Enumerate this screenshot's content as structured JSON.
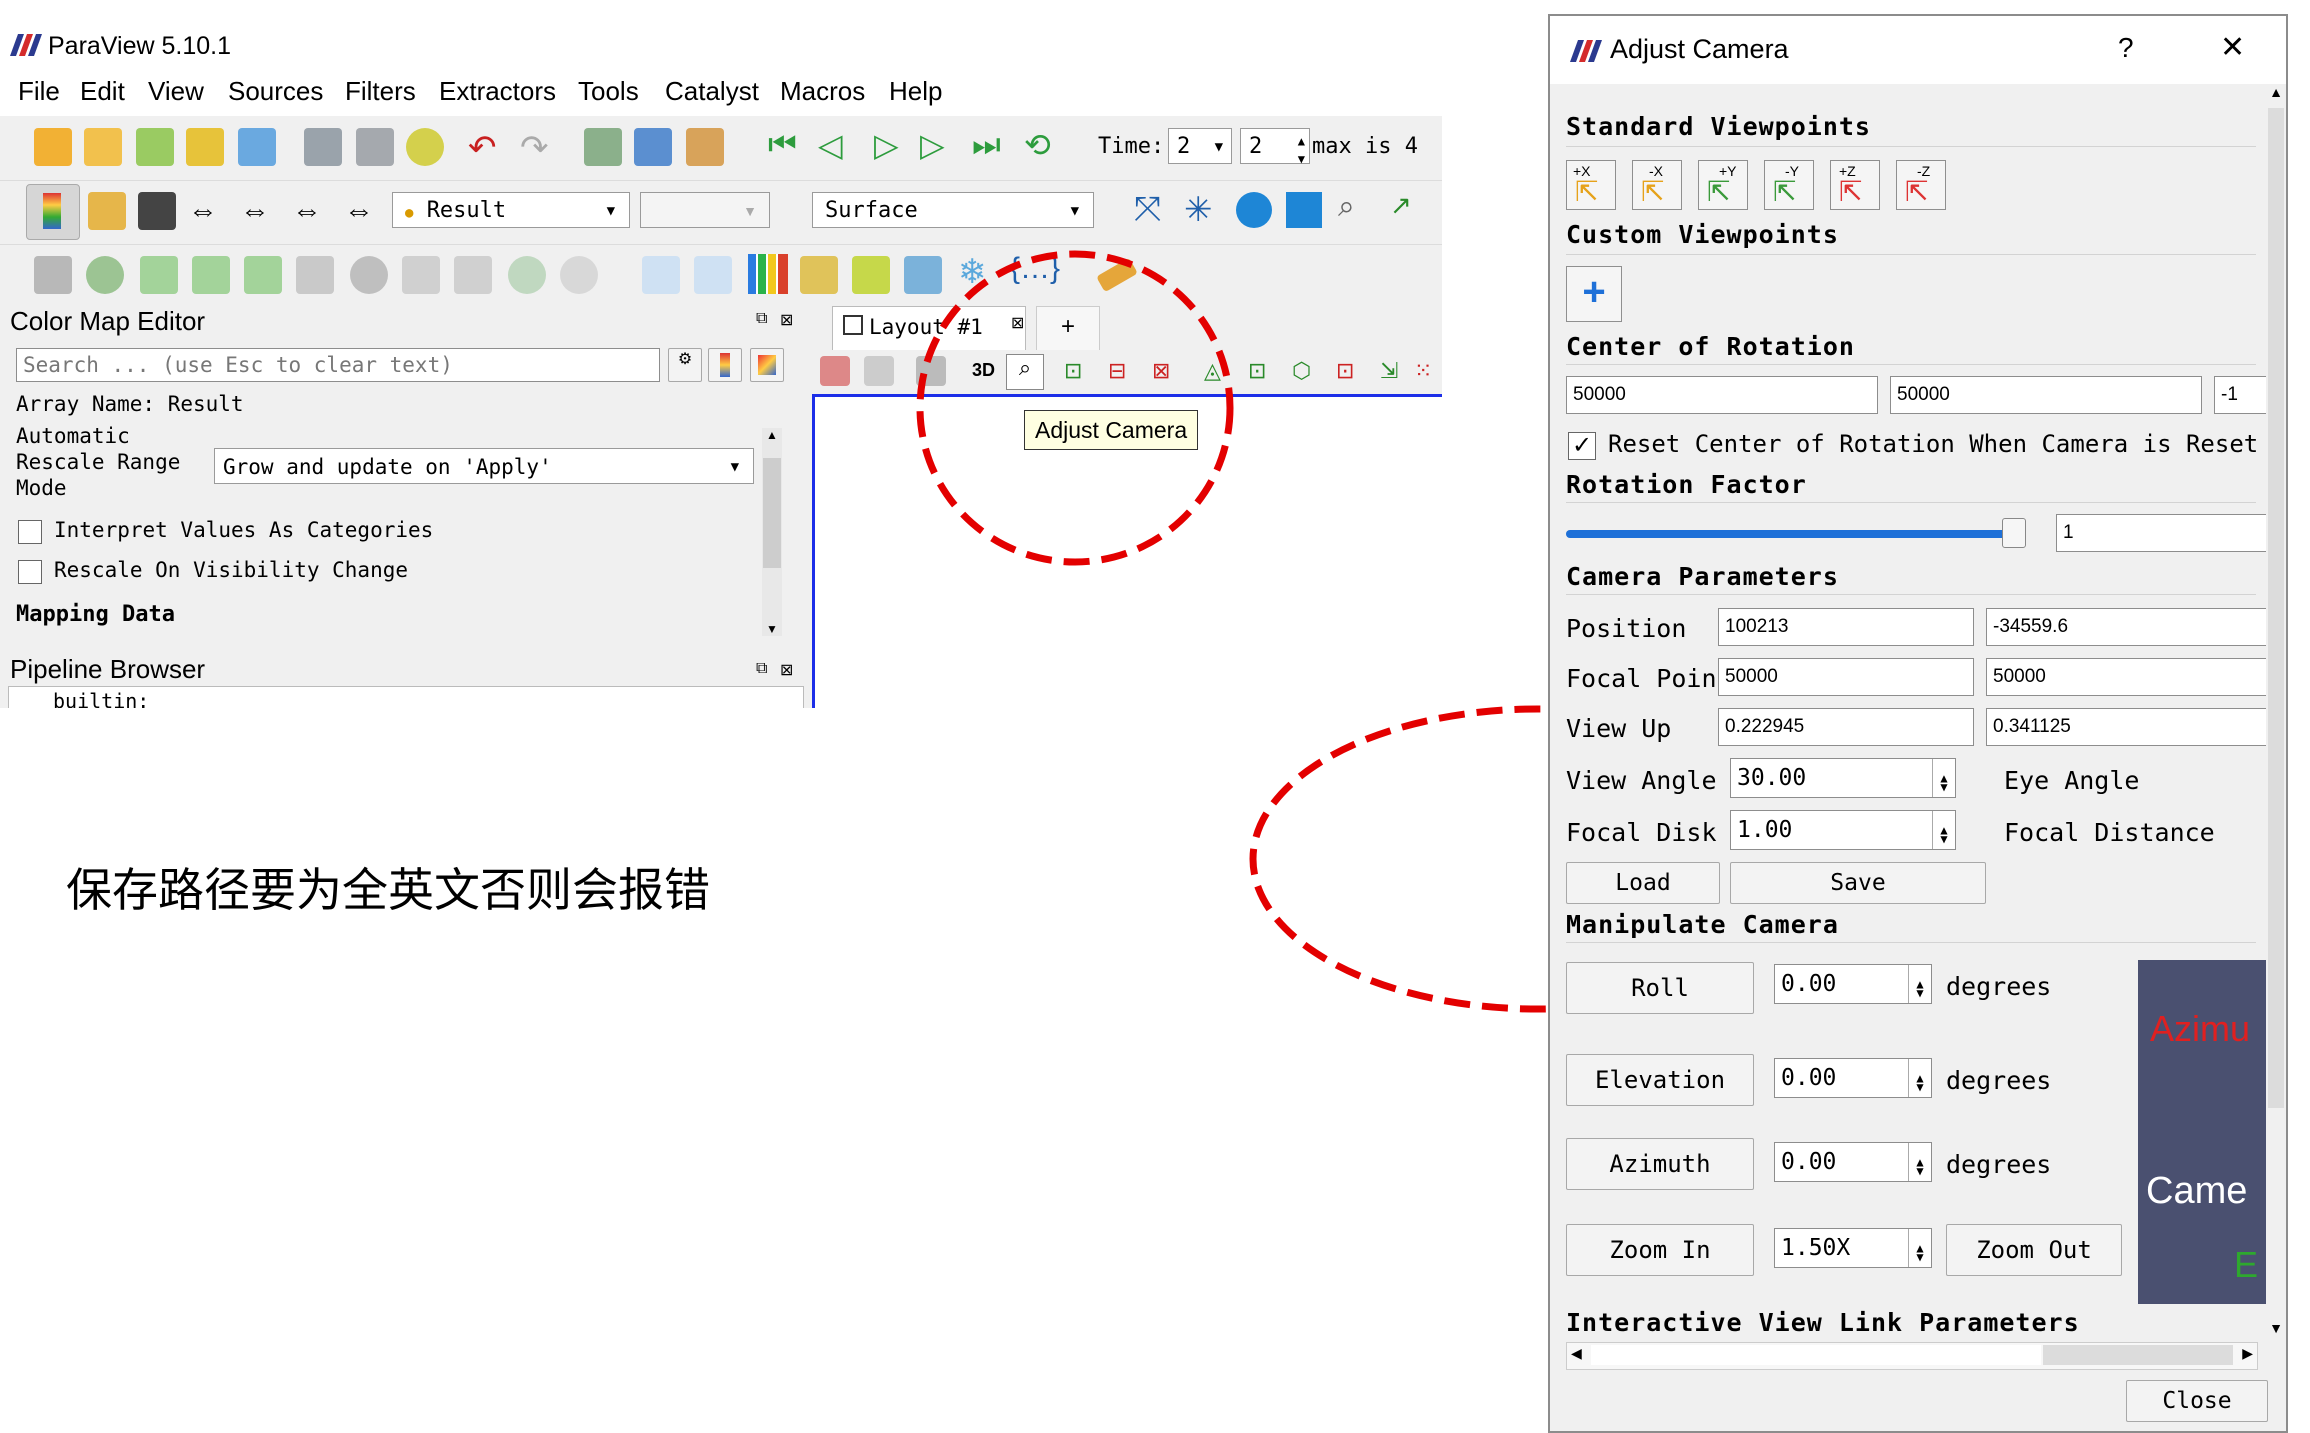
{
  "app": {
    "title": "ParaView 5.10.1",
    "menu": [
      "File",
      "Edit",
      "View",
      "Sources",
      "Filters",
      "Extractors",
      "Tools",
      "Catalyst",
      "Macros",
      "Help"
    ],
    "time_label": "Time:",
    "time_combo_value": "2",
    "time_spin_value": "2",
    "time_max": "max is 4",
    "result_combo": "Result",
    "representation_combo": "Surface"
  },
  "color_map_editor": {
    "title": "Color Map Editor",
    "search_placeholder": "Search ... (use Esc to clear text)",
    "array_name": "Array Name: Result",
    "rescale_label_1": "Automatic",
    "rescale_label_2": "Rescale Range",
    "rescale_label_3": "Mode",
    "rescale_value": "Grow and update on 'Apply'",
    "interpret_label": "Interpret Values As Categories",
    "rescale_visibility_label": "Rescale On Visibility Change",
    "mapping_data": "Mapping Data"
  },
  "pipeline_browser": {
    "title": "Pipeline Browser",
    "item": "builtin:"
  },
  "layout": {
    "tab_label": "Layout #1",
    "add_tab": "+",
    "mode_3d": "3D",
    "tooltip": "Adjust Camera"
  },
  "annotation": "保存路径要为全英文否则会报错",
  "dialog": {
    "title": "Adjust Camera",
    "help": "?",
    "close_x": "✕",
    "standard_viewpoints": "Standard Viewpoints",
    "viewpoint_buttons": [
      "+X",
      "-X",
      "+Y",
      "-Y",
      "+Z",
      "-Z"
    ],
    "custom_viewpoints": "Custom Viewpoints",
    "add_custom": "+",
    "center_of_rotation": "Center of Rotation",
    "center_values": [
      "50000",
      "50000",
      "-1"
    ],
    "reset_center_label": "Reset Center of Rotation When Camera is Reset",
    "rotation_factor": "Rotation Factor",
    "rotation_factor_value": "1",
    "rotation_factor_level": 1.0,
    "camera_parameters": "Camera Parameters",
    "position_label": "Position",
    "position_values": [
      "100213",
      "-34559.6"
    ],
    "focal_point_label": "Focal Point",
    "focal_point_values": [
      "50000",
      "50000"
    ],
    "view_up_label": "View Up",
    "view_up_values": [
      "0.222945",
      "0.341125"
    ],
    "view_angle_label": "View Angle",
    "view_angle_value": "30.00",
    "eye_angle_label": "Eye Angle",
    "focal_disk_label": "Focal Disk",
    "focal_disk_value": "1.00",
    "focal_distance_label": "Focal Distance",
    "load_label": "Load",
    "save_label": "Save",
    "manipulate_camera": "Manipulate Camera",
    "roll_label": "Roll",
    "roll_value": "0.00",
    "elevation_label": "Elevation",
    "elevation_value": "0.00",
    "azimuth_label": "Azimuth",
    "azimuth_value": "0.00",
    "degrees": "degrees",
    "zoom_in_label": "Zoom In",
    "zoom_value": "1.50X",
    "zoom_out_label": "Zoom Out",
    "preview_text_1": "Azimu",
    "preview_text_2": "Came",
    "preview_text_3": "E",
    "interactive_link": "Interactive View Link Parameters",
    "close_label": "Close"
  },
  "colors": {
    "highlight_red": "#e30000",
    "accent_blue": "#1e70d8",
    "viewport_border": "#1c2ee8",
    "preview_bg": "#4a5070"
  }
}
